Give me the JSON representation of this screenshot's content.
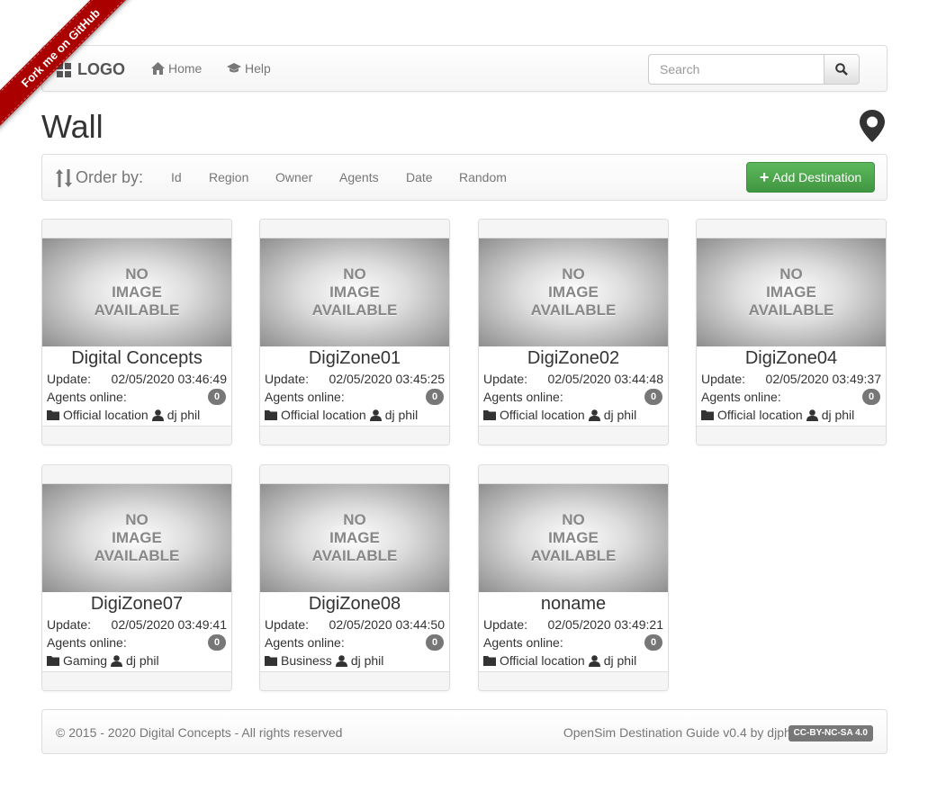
{
  "ribbon": {
    "label": "Fork me on GitHub"
  },
  "navbar": {
    "brand": "LOGO",
    "home": "Home",
    "help": "Help",
    "search_placeholder": "Search"
  },
  "page": {
    "title": "Wall"
  },
  "order": {
    "label": "Order by:",
    "options": [
      "Id",
      "Region",
      "Owner",
      "Agents",
      "Date",
      "Random"
    ],
    "add_button": "Add Destination"
  },
  "image_placeholder": [
    "NO",
    "IMAGE",
    "AVAILABLE"
  ],
  "labels": {
    "update": "Update:",
    "agents": "Agents online:"
  },
  "destinations": [
    {
      "name": "Digital Concepts",
      "update": "02/05/2020 03:46:49",
      "agents": "0",
      "category": "Official location",
      "owner": "dj phil"
    },
    {
      "name": "DigiZone01",
      "update": "02/05/2020 03:45:25",
      "agents": "0",
      "category": "Official location",
      "owner": "dj phil"
    },
    {
      "name": "DigiZone02",
      "update": "02/05/2020 03:44:48",
      "agents": "0",
      "category": "Official location",
      "owner": "dj phil"
    },
    {
      "name": "DigiZone04",
      "update": "02/05/2020 03:49:37",
      "agents": "0",
      "category": "Official location",
      "owner": "dj phil"
    },
    {
      "name": "DigiZone07",
      "update": "02/05/2020 03:49:41",
      "agents": "0",
      "category": "Gaming",
      "owner": "dj phil"
    },
    {
      "name": "DigiZone08",
      "update": "02/05/2020 03:44:50",
      "agents": "0",
      "category": "Business",
      "owner": "dj phil"
    },
    {
      "name": "noname",
      "update": "02/05/2020 03:49:21",
      "agents": "0",
      "category": "Official location",
      "owner": "dj phil"
    }
  ],
  "footer": {
    "copyright": "© 2015 - 2020 Digital Concepts - All rights reserved",
    "credit": "OpenSim Destination Guide v0.4 by djphil",
    "license": "CC-BY-NC-SA 4.0"
  },
  "colors": {
    "accent_green": "#5cb85c",
    "ribbon_red": "#aa0000",
    "badge_gray": "#777777"
  }
}
